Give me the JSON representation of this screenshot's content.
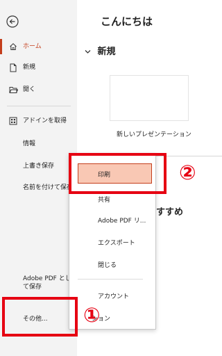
{
  "sidebar": {
    "back_icon": "arrow-left-icon",
    "items": [
      {
        "label": "ホーム",
        "icon": "home-icon"
      },
      {
        "label": "新規",
        "icon": "new-file-icon"
      },
      {
        "label": "開く",
        "icon": "folder-open-icon"
      },
      {
        "label": "アドインを取得",
        "icon": "addins-grid-icon"
      },
      {
        "label": "情報"
      },
      {
        "label": "上書き保存"
      },
      {
        "label": "名前を付けて保存"
      },
      {
        "label": "Adobe PDF として保存"
      },
      {
        "label": "その他..."
      }
    ]
  },
  "main": {
    "greeting": "こんにちは",
    "section_title": "新規",
    "template_label": "新しいプレゼンテーション",
    "partial_heading": "すすめ"
  },
  "menu": {
    "items": [
      {
        "label": "印刷"
      },
      {
        "label": "共有"
      },
      {
        "label": "Adobe PDF リ..."
      },
      {
        "label": "エクスポート"
      },
      {
        "label": "閉じる"
      },
      {
        "label": "アカウント"
      },
      {
        "label": "ション"
      }
    ]
  },
  "annotations": {
    "step1": "①",
    "step2": "②",
    "color": "#e60012"
  },
  "colors": {
    "accent": "#c43e1c",
    "highlight": "#f9c8b4"
  }
}
